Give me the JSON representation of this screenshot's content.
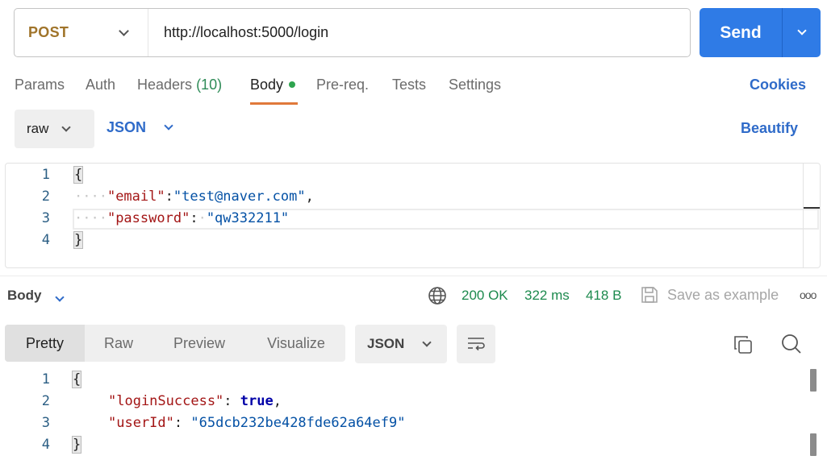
{
  "request": {
    "method": "POST",
    "url": "http://localhost:5000/login",
    "send_label": "Send"
  },
  "tabs": {
    "params": "Params",
    "auth": "Auth",
    "headers": "Headers",
    "headers_count": "(10)",
    "body": "Body",
    "prereq": "Pre-req.",
    "tests": "Tests",
    "settings": "Settings",
    "cookies": "Cookies"
  },
  "body_controls": {
    "mode": "raw",
    "language": "JSON",
    "beautify": "Beautify"
  },
  "request_editor": {
    "line_numbers": [
      "1",
      "2",
      "3",
      "4"
    ],
    "open_brace": "{",
    "close_brace": "}",
    "indent": "····",
    "email_key": "\"email\"",
    "email_sep": ":",
    "email_value": "\"test@naver.com\"",
    "email_comma": ",",
    "password_key": "\"password\"",
    "password_sep": ":",
    "password_space": "·",
    "password_value": "\"qw332211\""
  },
  "response": {
    "section_label": "Body",
    "status": "200 OK",
    "time": "322 ms",
    "size": "418 B",
    "save_label": "Save as example",
    "more": "ooo",
    "views": [
      "Pretty",
      "Raw",
      "Preview",
      "Visualize"
    ],
    "language": "JSON",
    "line_numbers": [
      "1",
      "2",
      "3",
      "4"
    ],
    "open_brace": "{",
    "close_brace": "}",
    "login_key": "\"loginSuccess\"",
    "login_sep": ": ",
    "login_value": "true",
    "login_comma": ",",
    "user_key": "\"userId\"",
    "user_sep": ": ",
    "user_value": "\"65dcb232be428fde62a64ef9\""
  },
  "colors": {
    "accent": "#2f7be6",
    "method": "#a0742a",
    "success": "#1d8a4e",
    "link": "#2f6bc9",
    "tab_indicator": "#e0793b"
  },
  "icons": [
    "chevron-down-icon",
    "globe-icon",
    "save-icon",
    "more-icon",
    "wrap-icon",
    "copy-icon",
    "search-icon"
  ]
}
